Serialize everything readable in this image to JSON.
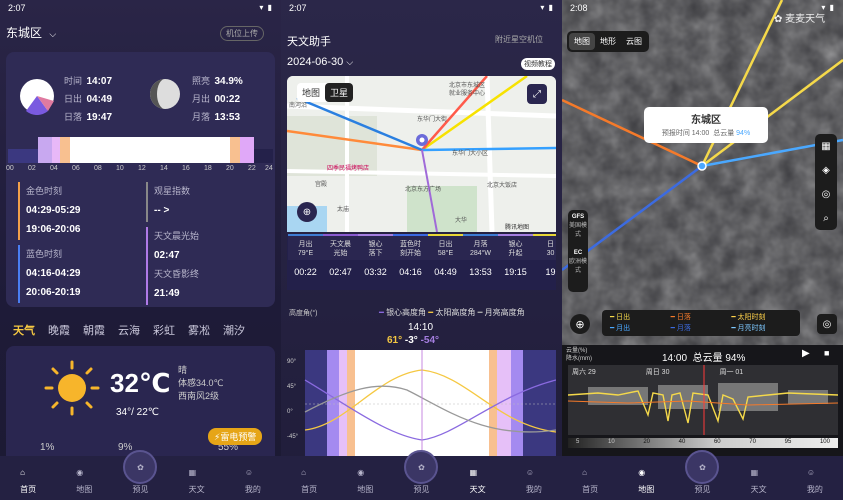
{
  "panel1": {
    "status_time": "2:07",
    "location": "东城区",
    "locate_btn": "机位上传",
    "sun": {
      "time_label": "时间",
      "time": "14:07",
      "rise_label": "日出",
      "rise": "04:49",
      "set_label": "日落",
      "set": "19:47"
    },
    "moon": {
      "illum_label": "照亮",
      "illum": "34.9%",
      "rise_label": "月出",
      "rise": "00:22",
      "set_label": "月落",
      "set": "13:53"
    },
    "timeline_ticks": [
      "00",
      "02",
      "04",
      "06",
      "08",
      "10",
      "12",
      "14",
      "16",
      "18",
      "20",
      "22",
      "24"
    ],
    "golden_label": "金色时刻",
    "golden_am": "04:29-05:29",
    "golden_pm": "19:06-20:06",
    "viewing_label": "观星指数",
    "viewing_value": "-- >",
    "blue_label": "蓝色时刻",
    "blue_am": "04:16-04:29",
    "blue_pm": "20:06-20:19",
    "dawn_label": "天文晨光始",
    "dawn_value": "02:47",
    "dusk_label": "天文昏影终",
    "dusk_value": "21:49",
    "tabs": [
      "天气",
      "晚霞",
      "朝霞",
      "云海",
      "彩虹",
      "雾凇",
      "潮汐"
    ],
    "weather": {
      "temp": "32℃",
      "cond": "晴",
      "feels": "体感34.0℃",
      "wind": "西南风2级",
      "range": "34°/ 22℃"
    },
    "bottom_row": [
      "1%",
      "9%",
      "55%"
    ],
    "warning": "雷电预警"
  },
  "nav": {
    "home": "首页",
    "map": "地图",
    "forecast": "预见",
    "astro": "天文",
    "me": "我的"
  },
  "panel2": {
    "status_time": "2:07",
    "title": "天文助手",
    "title_right": "附近星空机位",
    "date": "2024-06-30",
    "tutorial": "视频教程",
    "map_tab": "地图",
    "sat_tab": "卫星",
    "map_labels": {
      "l1": "东华门大街",
      "l2": "北京市东城区",
      "l3": "就业服务中心",
      "l4": "南池子",
      "l5": "南河沿",
      "l6": "东华门大街",
      "l7": "东华门大小区",
      "l8": "四季民福烤鸭店",
      "l9": "宫殿",
      "l10": "北京东方广场",
      "l11": "北京大饭店",
      "l12": "太庙",
      "l13": "东单",
      "l14": "北京市第166中学",
      "l15": "大华",
      "l16": "腾讯地图"
    },
    "table": [
      {
        "h": "月出",
        "s": "79°E",
        "v": "00:22",
        "c": "#3d7cd3"
      },
      {
        "h": "天文晨",
        "s": "光始",
        "v": "02:47",
        "c": "#8a5ad0"
      },
      {
        "h": "银心",
        "s": "落下",
        "v": "03:32",
        "c": "#a57ee0"
      },
      {
        "h": "蓝色时",
        "s": "刻开始",
        "v": "04:16",
        "c": "#3a68e0"
      },
      {
        "h": "日出",
        "s": "58°E",
        "v": "04:49",
        "c": "#e8d636"
      },
      {
        "h": "月落",
        "s": "284°W",
        "v": "13:53",
        "c": "#3d7cd3"
      },
      {
        "h": "银心",
        "s": "升起",
        "v": "19:15",
        "c": "#a57ee0"
      },
      {
        "h": "日",
        "s": "30",
        "v": "19",
        "c": "#e8d636"
      }
    ],
    "alt_label": "高度角(°)",
    "legend": [
      "银心高度角",
      "太阳高度角",
      "月亮高度角"
    ],
    "chart_time": "14:10",
    "vals": [
      "61°",
      "-3°",
      "-54°"
    ],
    "axis": [
      "90°",
      "45°",
      "0°",
      "-45°",
      "-90°"
    ]
  },
  "panel3": {
    "status_time": "2:08",
    "brand": "麦麦天气",
    "tabs": [
      "地图",
      "地形",
      "云图"
    ],
    "place": "东城区",
    "forecast_time_label": "预报时间",
    "forecast_time": "14:00",
    "cloud_label": "总云量",
    "cloud_value": "94%",
    "models": [
      {
        "name": "GFS",
        "sub": "美国模式"
      },
      {
        "name": "EC",
        "sub": "欧洲模式"
      }
    ],
    "legend": [
      {
        "label": "日出",
        "color": "#f5d94a"
      },
      {
        "label": "日落",
        "color": "#f57a2a"
      },
      {
        "label": "太阳时刻",
        "color": "#ffd24a"
      },
      {
        "label": "月出",
        "color": "#4aa8ff"
      },
      {
        "label": "月落",
        "color": "#3c6be0"
      },
      {
        "label": "月亮时刻",
        "color": "#7ec8ff"
      }
    ],
    "cloud_y_label": "云量(%)",
    "rain_label": "降水(mm)",
    "timebar": "14:00",
    "timebar_cloud": "总云量 94%",
    "days": [
      "周六 29",
      "周日 30",
      "周一 01"
    ],
    "ticks": [
      "5",
      "10",
      "20",
      "40",
      "60",
      "70",
      "95",
      "100"
    ]
  }
}
